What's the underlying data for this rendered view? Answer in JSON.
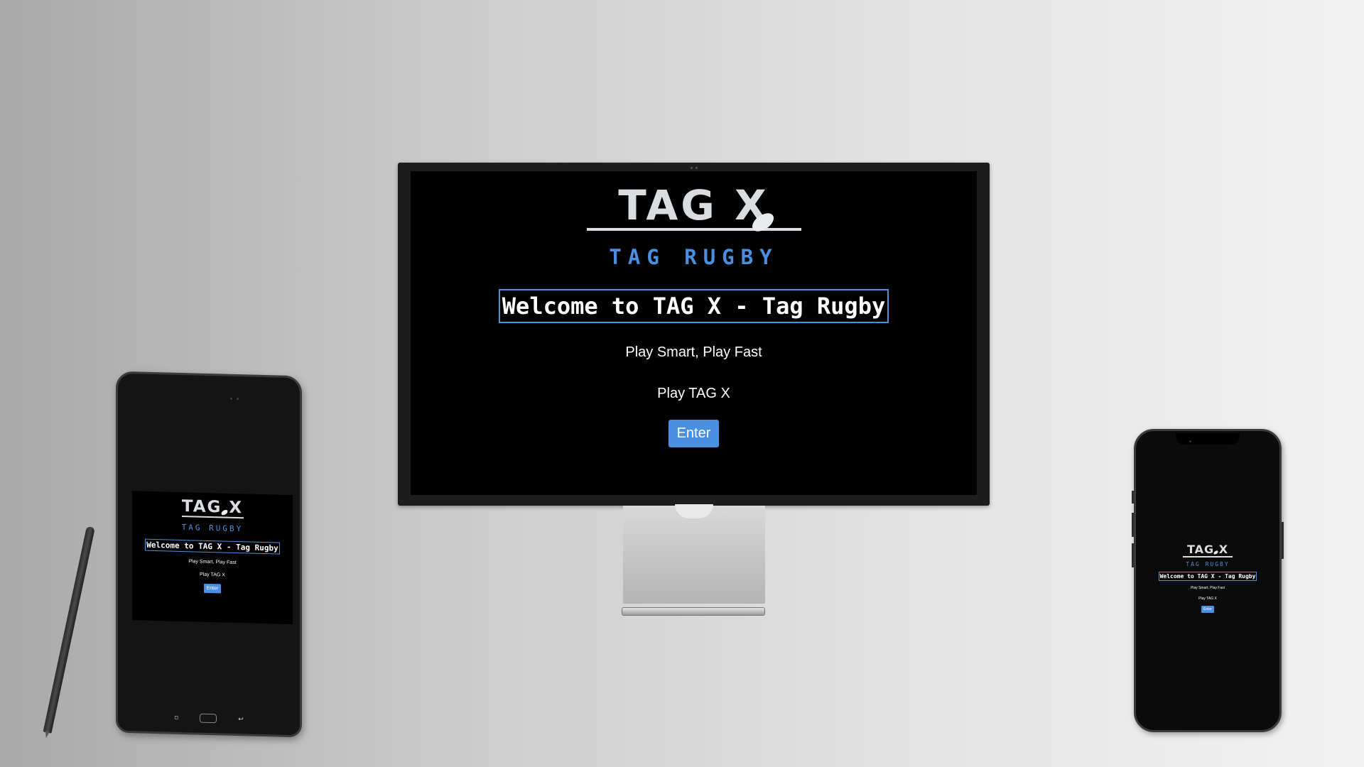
{
  "site": {
    "logo_text": "TAG X",
    "logo_subtitle": "TAG RUGBY",
    "welcome_heading": "Welcome to TAG X - Tag Rugby",
    "tagline_1": "Play Smart, Play Fast",
    "tagline_2": "Play TAG X",
    "enter_label": "Enter"
  },
  "colors": {
    "accent": "#4a90e2",
    "screen_background": "#000000",
    "text": "#ffffff",
    "logo": "#d9dde0"
  },
  "devices": [
    "desktop-monitor",
    "tablet",
    "smartphone"
  ]
}
